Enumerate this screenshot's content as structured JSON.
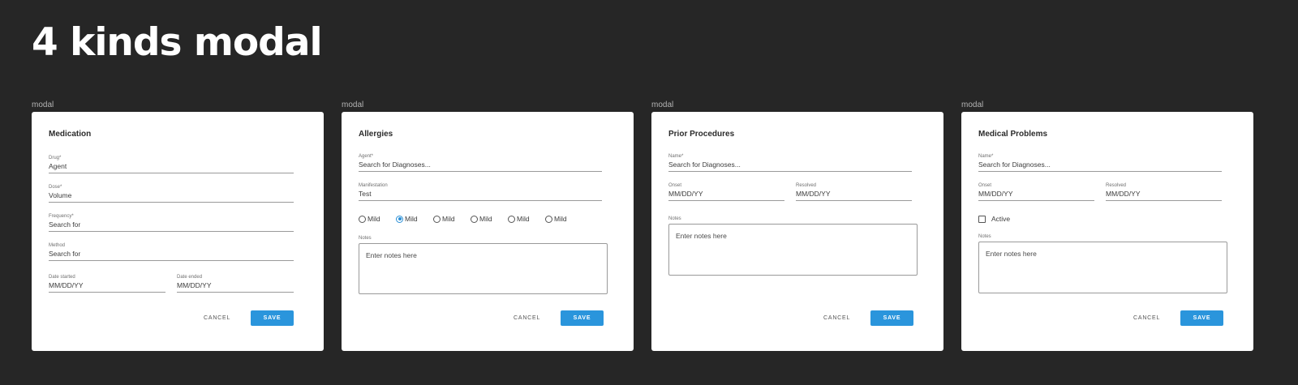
{
  "page": {
    "title": "4 kinds modal"
  },
  "colors": {
    "background": "#262626",
    "accent": "#2a95dc",
    "card": "#ffffff"
  },
  "modals": [
    {
      "frame_label": "modal",
      "title": "Medication",
      "fields": [
        {
          "label": "Drug*",
          "value": "Agent"
        },
        {
          "label": "Dose*",
          "value": "Volume"
        },
        {
          "label": "Frequency*",
          "value": "Search for"
        },
        {
          "label": "Method",
          "value": "Search for"
        },
        {
          "label": "Date started",
          "value": "MM/DD/YY"
        },
        {
          "label": "Date ended",
          "value": "MM/DD/YY"
        }
      ],
      "cancel_label": "CANCEL",
      "save_label": "SAVE"
    },
    {
      "frame_label": "modal",
      "title": "Allergies",
      "fields": [
        {
          "label": "Agent*",
          "value": "Search for Diagnoses..."
        },
        {
          "label": "Manifestation",
          "value": "Test"
        }
      ],
      "radio_options": [
        {
          "label": "Mild",
          "selected": false
        },
        {
          "label": "Mild",
          "selected": true
        },
        {
          "label": "Mild",
          "selected": false
        },
        {
          "label": "Mild",
          "selected": false
        },
        {
          "label": "Mild",
          "selected": false
        },
        {
          "label": "Mild",
          "selected": false
        }
      ],
      "notes_label": "Notes",
      "notes_placeholder": "Enter notes here",
      "cancel_label": "CANCEL",
      "save_label": "SAVE"
    },
    {
      "frame_label": "modal",
      "title": "Prior Procedures",
      "fields": [
        {
          "label": "Name*",
          "value": "Search for Diagnoses..."
        },
        {
          "label": "Onset",
          "value": "MM/DD/YY"
        },
        {
          "label": "Resolved",
          "value": "MM/DD/YY"
        }
      ],
      "notes_label": "Notes",
      "notes_placeholder": "Enter notes here",
      "cancel_label": "CANCEL",
      "save_label": "SAVE"
    },
    {
      "frame_label": "modal",
      "title": "Medical Problems",
      "fields": [
        {
          "label": "Name*",
          "value": "Search for Diagnoses..."
        },
        {
          "label": "Onset",
          "value": "MM/DD/YY"
        },
        {
          "label": "Resolved",
          "value": "MM/DD/YY"
        }
      ],
      "checkbox": {
        "label": "Active",
        "checked": false
      },
      "notes_label": "Notes",
      "notes_placeholder": "Enter notes here",
      "cancel_label": "CANCEL",
      "save_label": "SAVE"
    }
  ]
}
